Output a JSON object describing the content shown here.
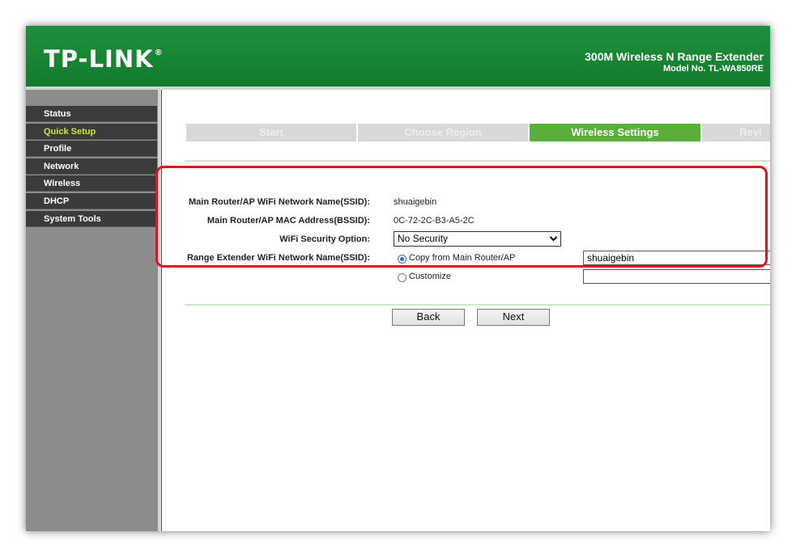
{
  "header": {
    "logo": "TP-LINK",
    "logo_mark": "®",
    "product_name": "300M Wireless N Range Extender",
    "model": "Model No. TL-WA850RE",
    "colors": {
      "green": "#178432",
      "active_step": "#5aaf3a",
      "highlight": "#e0121c"
    }
  },
  "sidebar": {
    "items": [
      {
        "label": "Status",
        "active": false
      },
      {
        "label": "Quick Setup",
        "active": true
      },
      {
        "label": "Profile",
        "active": false
      },
      {
        "label": "Network",
        "active": false
      },
      {
        "label": "Wireless",
        "active": false
      },
      {
        "label": "DHCP",
        "active": false
      },
      {
        "label": "System Tools",
        "active": false
      }
    ]
  },
  "steps": [
    {
      "label": "Start",
      "active": false
    },
    {
      "label": "Choose Region",
      "active": false
    },
    {
      "label": "Wireless Settings",
      "active": true
    },
    {
      "label": "Revi",
      "active": false
    }
  ],
  "form": {
    "ssid_label": "Main Router/AP WiFi Network Name(SSID):",
    "ssid_value": "shuaigebin",
    "bssid_label": "Main Router/AP MAC Address(BSSID):",
    "bssid_value": "0C-72-2C-B3-A5-2C",
    "security_label": "WiFi Security Option:",
    "security_value": "No Security",
    "extender_label": "Range Extender WiFi Network Name(SSID):",
    "copy_option_label": "Copy from Main Router/AP",
    "copy_option_value": "shuaigebin",
    "customize_label": "Customize",
    "customize_value": ""
  },
  "buttons": {
    "back": "Back",
    "next": "Next"
  }
}
